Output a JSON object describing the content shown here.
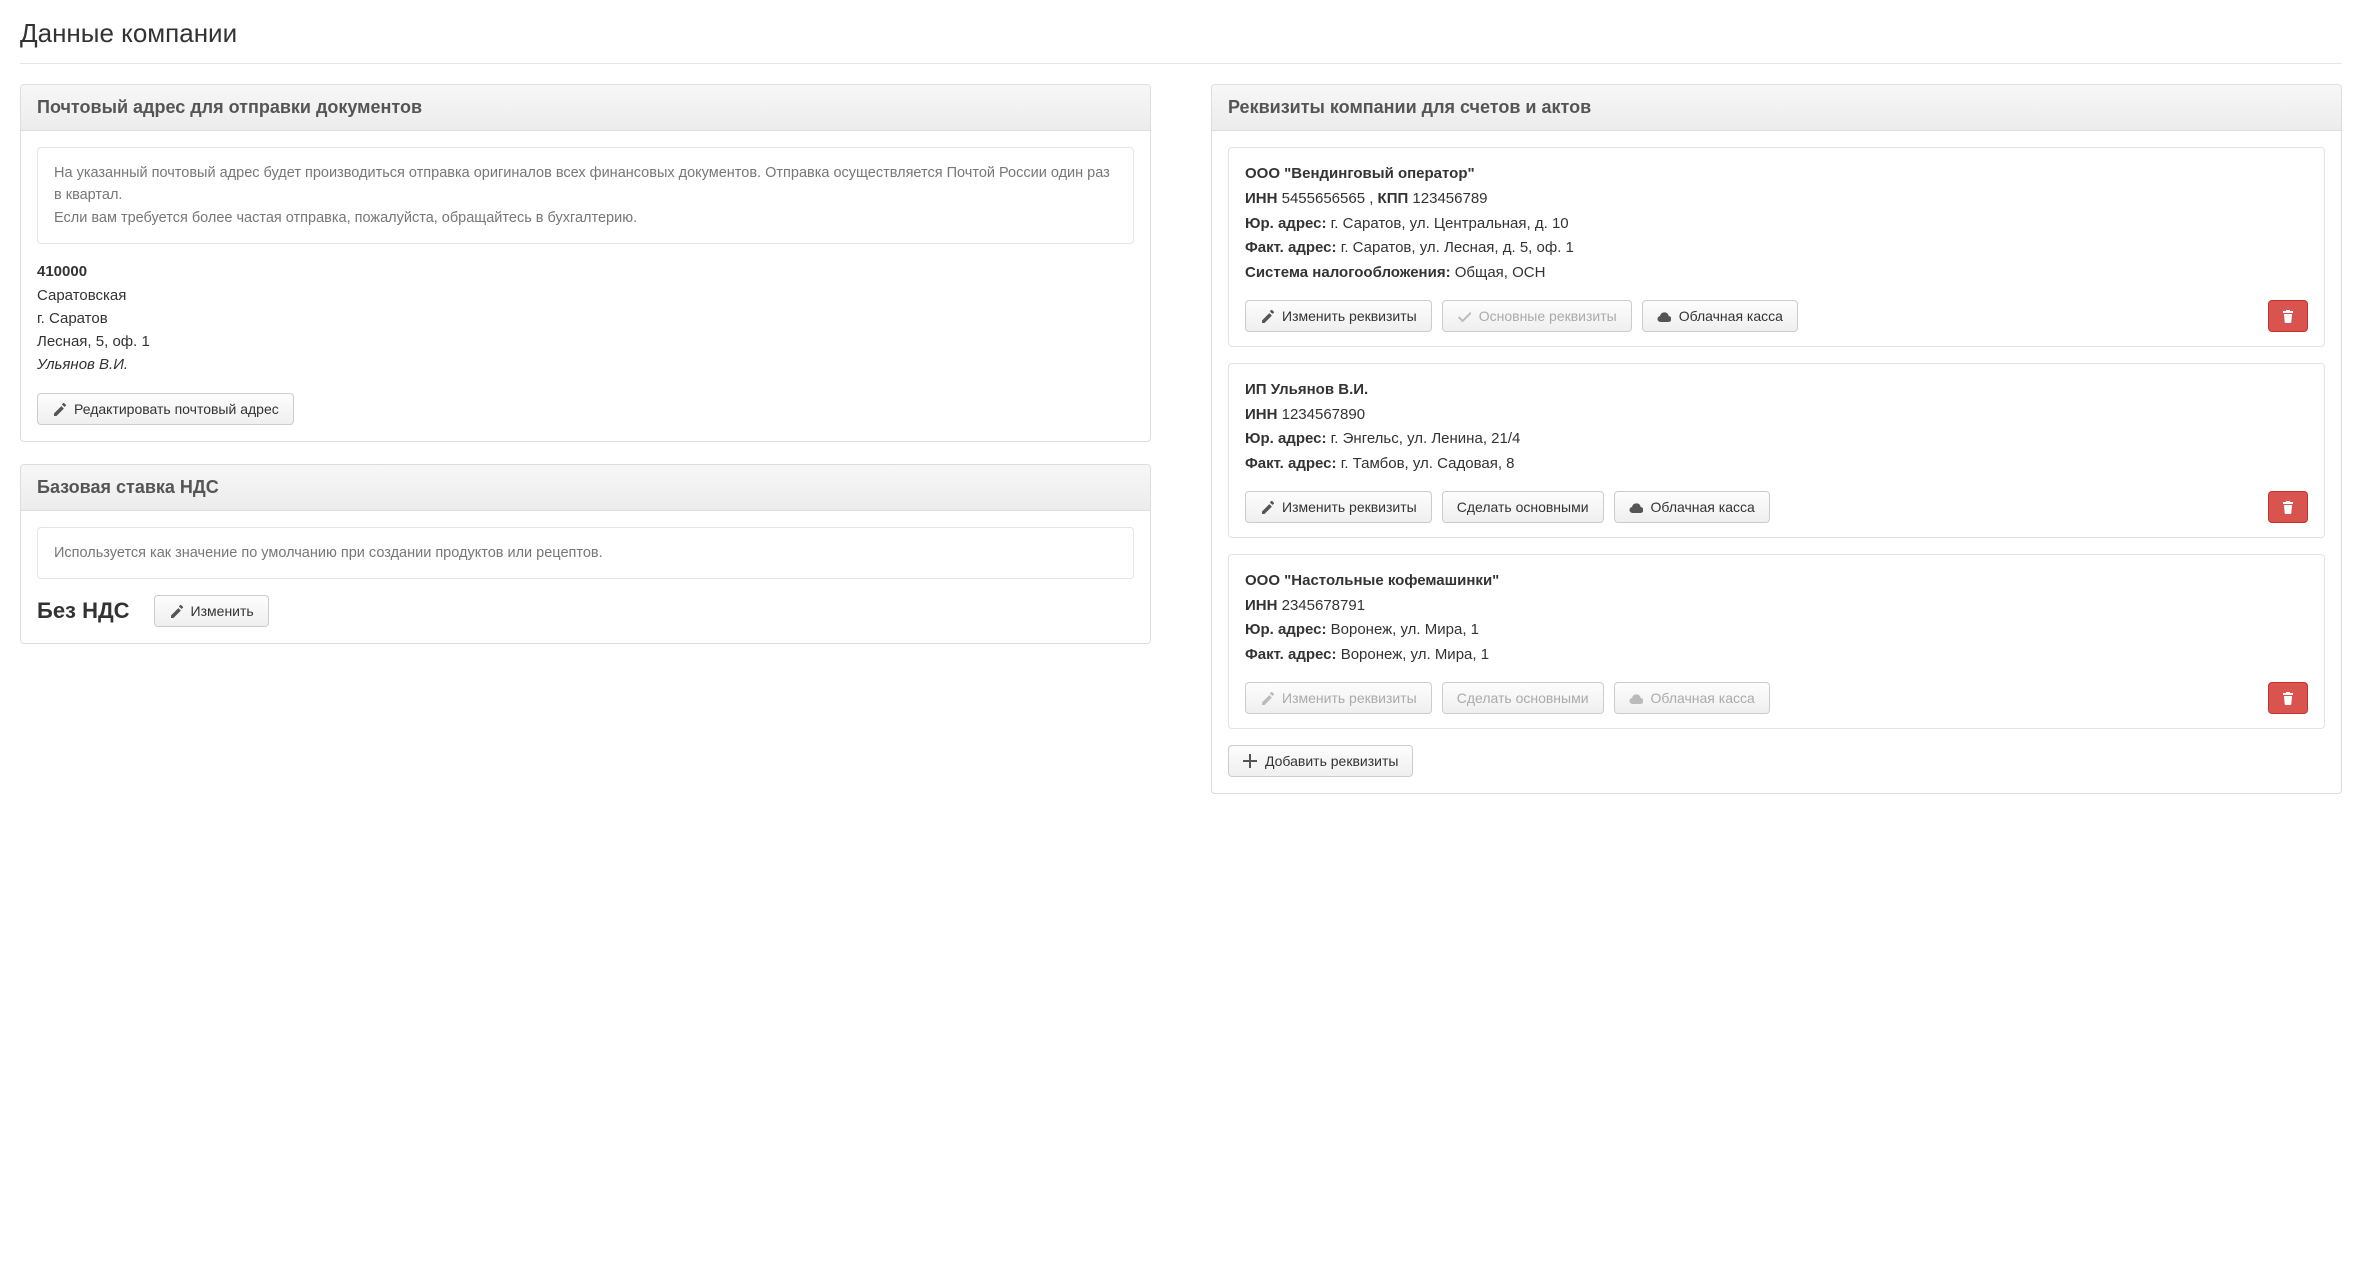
{
  "page_title": "Данные компании",
  "postal": {
    "panel_title": "Почтовый адрес для отправки документов",
    "info_p1": "На указанный почтовый адрес будет производиться отправка оригиналов всех финансовых документов. Отправка осуществляется Почтой России один раз в квартал.",
    "info_p2": "Если вам требуется более частая отправка, пожалуйста, обращайтесь в бухгалтерию.",
    "zip": "410000",
    "region": "Саратовская",
    "city": "г. Саратов",
    "street": "Лесная, 5, оф. 1",
    "name": "Ульянов В.И.",
    "edit_btn": "Редактировать почтовый адрес"
  },
  "vat": {
    "panel_title": "Базовая ставка НДС",
    "info": "Используется как значение по умолчанию при создании продуктов или рецептов.",
    "value": "Без НДС",
    "edit_btn": "Изменить"
  },
  "requisites": {
    "panel_title": "Реквизиты компании для счетов и актов",
    "labels": {
      "inn": "ИНН",
      "kpp": "КПП",
      "legal_addr": "Юр. адрес:",
      "actual_addr": "Факт. адрес:",
      "tax_system": "Система налогообложения:"
    },
    "buttons": {
      "edit": "Изменить реквизиты",
      "main": "Основные реквизиты",
      "make_main": "Сделать основными",
      "cloud": "Облачная касса",
      "add": "Добавить реквизиты"
    },
    "items": [
      {
        "name": "ООО \"Вендинговый оператор\"",
        "inn": "5455656565",
        "kpp": "123456789",
        "legal_addr": "г. Саратов, ул. Центральная, д. 10",
        "actual_addr": "г. Саратов, ул. Лесная, д. 5, оф. 1",
        "tax_system": "Общая, ОСН",
        "is_main": true,
        "disabled": false
      },
      {
        "name": "ИП Ульянов В.И.",
        "inn": "1234567890",
        "kpp": "",
        "legal_addr": "г. Энгельс, ул. Ленина, 21/4",
        "actual_addr": "г. Тамбов, ул. Садовая, 8",
        "tax_system": "",
        "is_main": false,
        "disabled": false
      },
      {
        "name": "ООО \"Настольные кофемашинки\"",
        "inn": "2345678791",
        "kpp": "",
        "legal_addr": "Воронеж, ул. Мира, 1",
        "actual_addr": "Воронеж, ул. Мира, 1",
        "tax_system": "",
        "is_main": false,
        "disabled": true
      }
    ]
  }
}
